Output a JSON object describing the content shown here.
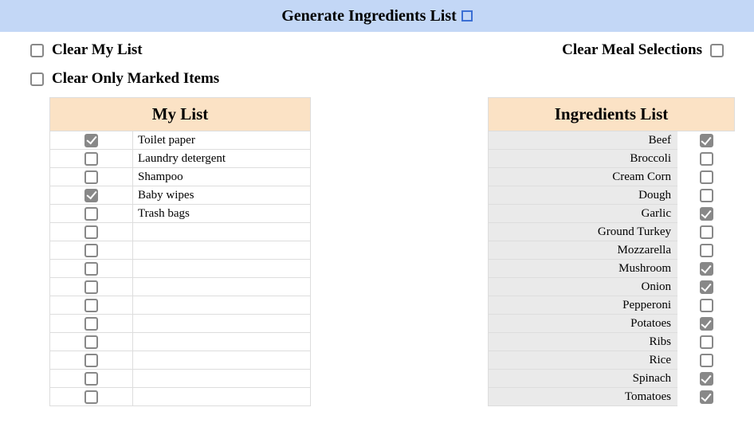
{
  "header": {
    "title": "Generate Ingredients List"
  },
  "actions": {
    "clear_my_list": "Clear My List",
    "clear_meal_selections": "Clear Meal Selections",
    "clear_only_marked": "Clear Only Marked Items"
  },
  "my_list": {
    "header": "My List",
    "rows": [
      {
        "checked": true,
        "label": "Toilet paper"
      },
      {
        "checked": false,
        "label": "Laundry detergent"
      },
      {
        "checked": false,
        "label": "Shampoo"
      },
      {
        "checked": true,
        "label": "Baby wipes"
      },
      {
        "checked": false,
        "label": "Trash bags"
      },
      {
        "checked": false,
        "label": ""
      },
      {
        "checked": false,
        "label": ""
      },
      {
        "checked": false,
        "label": ""
      },
      {
        "checked": false,
        "label": ""
      },
      {
        "checked": false,
        "label": ""
      },
      {
        "checked": false,
        "label": ""
      },
      {
        "checked": false,
        "label": ""
      },
      {
        "checked": false,
        "label": ""
      },
      {
        "checked": false,
        "label": ""
      },
      {
        "checked": false,
        "label": ""
      }
    ]
  },
  "ingredients": {
    "header": "Ingredients List",
    "rows": [
      {
        "label": "Beef",
        "checked": true
      },
      {
        "label": "Broccoli",
        "checked": false
      },
      {
        "label": "Cream Corn",
        "checked": false
      },
      {
        "label": "Dough",
        "checked": false
      },
      {
        "label": "Garlic",
        "checked": true
      },
      {
        "label": "Ground Turkey",
        "checked": false
      },
      {
        "label": "Mozzarella",
        "checked": false
      },
      {
        "label": "Mushroom",
        "checked": true
      },
      {
        "label": "Onion",
        "checked": true
      },
      {
        "label": "Pepperoni",
        "checked": false
      },
      {
        "label": "Potatoes",
        "checked": true
      },
      {
        "label": "Ribs",
        "checked": false
      },
      {
        "label": "Rice",
        "checked": false
      },
      {
        "label": "Spinach",
        "checked": true
      },
      {
        "label": "Tomatoes",
        "checked": true
      }
    ]
  }
}
